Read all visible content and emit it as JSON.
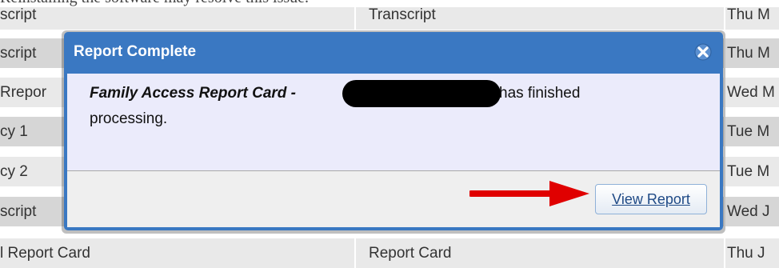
{
  "caption": "Reinstalling the software may resolve this issue.",
  "table": {
    "rows": [
      {
        "col1": "script",
        "col2": "Transcript",
        "col3": "Thu M"
      },
      {
        "col1": "script",
        "col2": "",
        "col3": "Thu M"
      },
      {
        "col1": "Rrepor",
        "col2": "",
        "col3": "Wed M"
      },
      {
        "col1": "cy 1",
        "col2": "",
        "col3": "Tue M"
      },
      {
        "col1": "cy 2",
        "col2": "",
        "col3": "Tue M"
      },
      {
        "col1": "script",
        "col2": "",
        "col3": "Wed J"
      },
      {
        "col1": "l Report Card",
        "col2": "Report Card",
        "col3": "Thu J"
      }
    ]
  },
  "modal": {
    "title": "Report Complete",
    "message_report": "Family Access Report Card -",
    "message_tail": "has finished",
    "message_line2": "processing.",
    "view_report_label": "View Report"
  },
  "colors": {
    "modal_header": "#3a78c2",
    "modal_body": "#ebebfb",
    "arrow": "#e00000"
  },
  "icons": {
    "close": "close-icon",
    "arrow": "red-arrow-pointer"
  }
}
